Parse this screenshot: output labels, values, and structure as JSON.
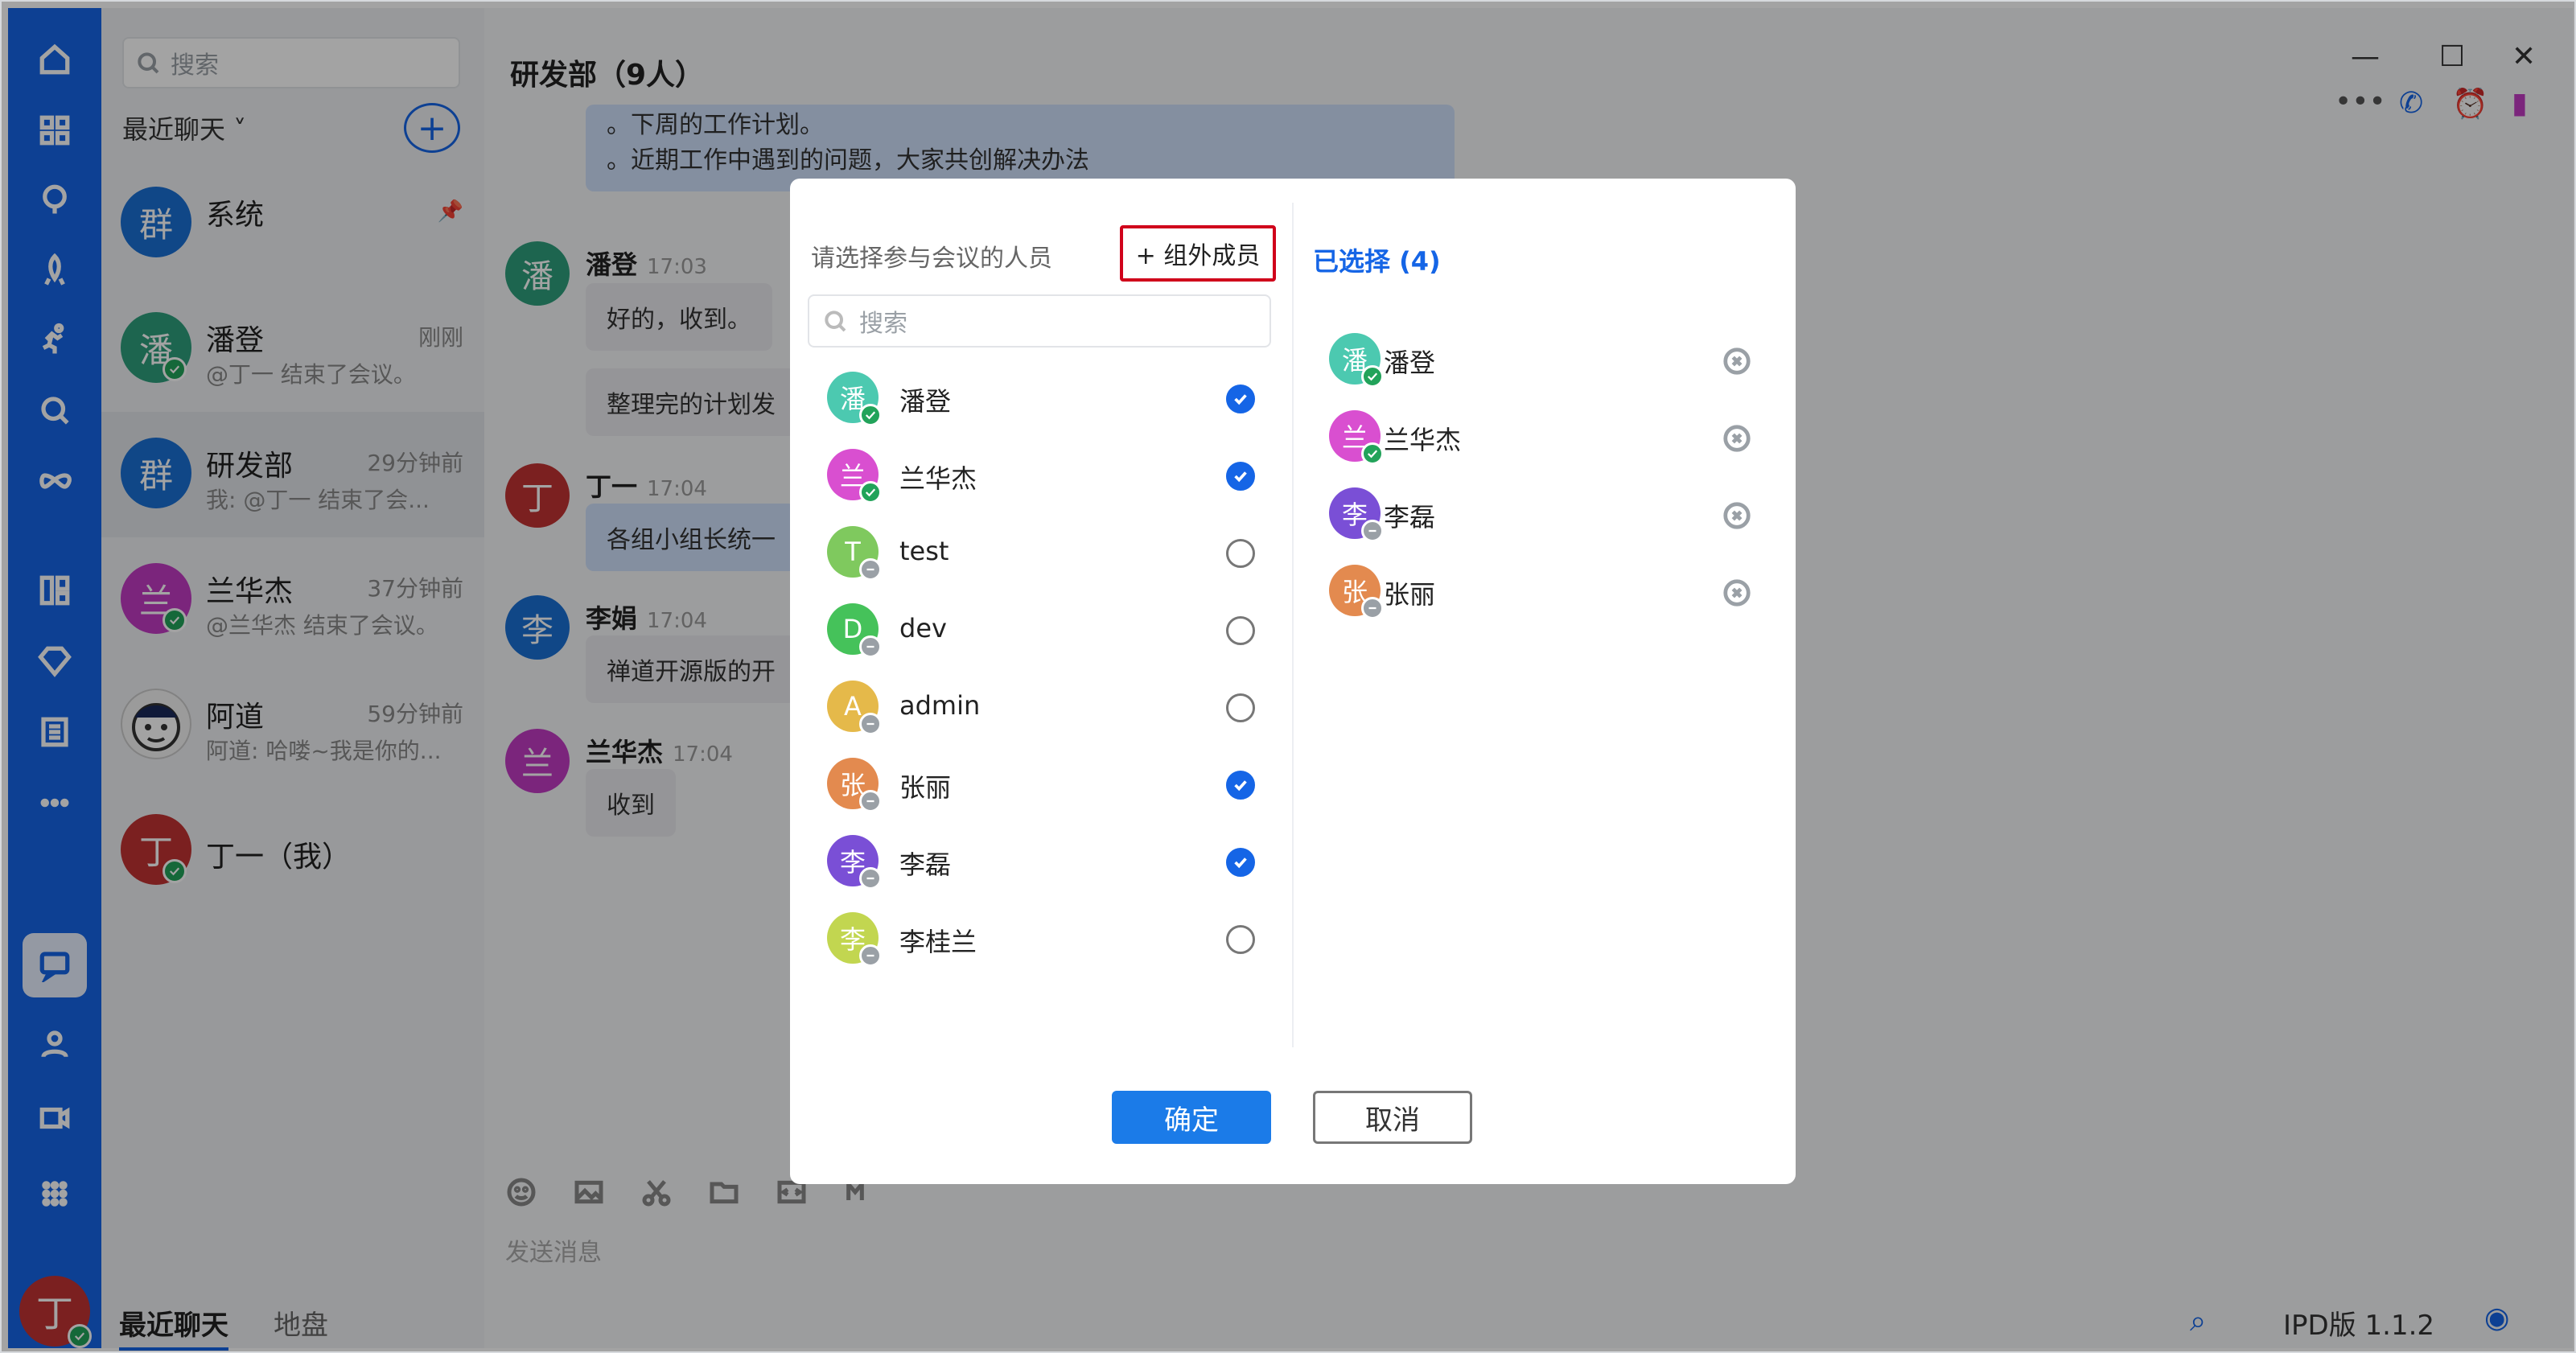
{
  "sidebar": {
    "search_placeholder": "搜索",
    "recent_label": "最近聊天 ˅",
    "add_symbol": "+",
    "conversations": [
      {
        "avatar": "群",
        "name": "系统",
        "time": "",
        "preview": "",
        "color": "#1a6fd3"
      },
      {
        "avatar": "潘",
        "name": "潘登",
        "time": "刚刚",
        "preview": "@丁一 结束了会议。",
        "color": "#2e9e7c"
      },
      {
        "avatar": "群",
        "name": "研发部",
        "time": "29分钟前",
        "preview": "我: @丁一 结束了会...",
        "color": "#1a6fd3"
      },
      {
        "avatar": "兰",
        "name": "兰华杰",
        "time": "37分钟前",
        "preview": "@兰华杰 结束了会议。",
        "color": "#c03ac2"
      },
      {
        "avatar": "",
        "name": "阿道",
        "time": "59分钟前",
        "preview": "阿道: 哈喽~我是你的...",
        "color": "#f3f3f3"
      },
      {
        "avatar": "丁",
        "name": "丁一（我）",
        "time": "",
        "preview": "",
        "color": "#c03232"
      }
    ]
  },
  "rail": {
    "me_avatar": "丁"
  },
  "chat": {
    "title": "研发部（9人）",
    "messages": [
      {
        "line1": "。下周的工作计划。",
        "line2": "。近期工作中遇到的问题，大家共创解决办法"
      },
      {
        "avatar": "潘",
        "sender": "潘登",
        "time": "17:03",
        "text": "好的，收到。"
      },
      {
        "text": "整理完的计划发"
      },
      {
        "avatar": "丁",
        "sender": "丁一",
        "time": "17:04",
        "text": "各组小组长统一"
      },
      {
        "avatar": "李",
        "sender": "李娟",
        "time": "17:04",
        "text": "禅道开源版的开"
      },
      {
        "avatar": "兰",
        "sender": "兰华杰",
        "time": "17:04",
        "text": "收到"
      }
    ],
    "compose_placeholder": "发送消息"
  },
  "bottom": {
    "tab_recent": "最近聊天",
    "tab_disk": "地盘",
    "version": "IPD版 1.1.2"
  },
  "dialog": {
    "hint": "请选择参与会议的人员",
    "external_button": "+ 组外成员",
    "search_placeholder": "搜索",
    "members": [
      {
        "avatar": "潘",
        "name": "潘登",
        "checked": true,
        "online": true,
        "color": "#4cc9b0"
      },
      {
        "avatar": "兰",
        "name": "兰华杰",
        "checked": true,
        "online": true,
        "color": "#d94fd0"
      },
      {
        "avatar": "T",
        "name": "test",
        "checked": false,
        "online": false,
        "color": "#7fc95e"
      },
      {
        "avatar": "D",
        "name": "dev",
        "checked": false,
        "online": false,
        "color": "#45c25a"
      },
      {
        "avatar": "A",
        "name": "admin",
        "checked": false,
        "online": false,
        "color": "#e5b94a"
      },
      {
        "avatar": "张",
        "name": "张丽",
        "checked": true,
        "online": false,
        "color": "#e38a4f"
      },
      {
        "avatar": "李",
        "name": "李磊",
        "checked": true,
        "online": false,
        "color": "#7a4fd6"
      },
      {
        "avatar": "李",
        "name": "李桂兰",
        "checked": false,
        "online": false,
        "color": "#c2d650"
      }
    ],
    "selected_title": "已选择 (4)",
    "selected": [
      {
        "avatar": "潘",
        "name": "潘登",
        "online": true,
        "color": "#4cc9b0"
      },
      {
        "avatar": "兰",
        "name": "兰华杰",
        "online": true,
        "color": "#d94fd0"
      },
      {
        "avatar": "李",
        "name": "李磊",
        "online": false,
        "color": "#7a4fd6"
      },
      {
        "avatar": "张",
        "name": "张丽",
        "online": false,
        "color": "#e38a4f"
      }
    ],
    "confirm_label": "确定",
    "cancel_label": "取消"
  }
}
